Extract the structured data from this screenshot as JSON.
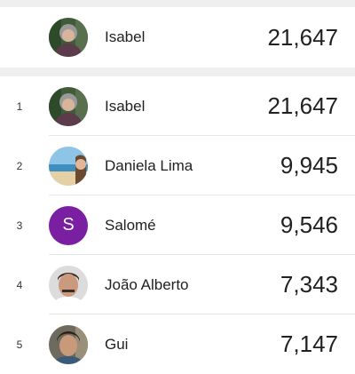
{
  "player": {
    "name": "Isabel",
    "score": "21,647",
    "avatar_icon": "person-photo-icon"
  },
  "leaderboard": [
    {
      "rank": "1",
      "name": "Isabel",
      "score": "21,647",
      "avatar_icon": "person-photo-icon"
    },
    {
      "rank": "2",
      "name": "Daniela Lima",
      "score": "9,945",
      "avatar_icon": "beach-photo-icon"
    },
    {
      "rank": "3",
      "name": "Salomé",
      "score": "9,546",
      "avatar_letter": "S",
      "avatar_color": "#7b1fa2"
    },
    {
      "rank": "4",
      "name": "João Alberto",
      "score": "7,343",
      "avatar_icon": "person-photo-icon"
    },
    {
      "rank": "5",
      "name": "Gui",
      "score": "7,147",
      "avatar_icon": "person-photo-icon"
    }
  ]
}
